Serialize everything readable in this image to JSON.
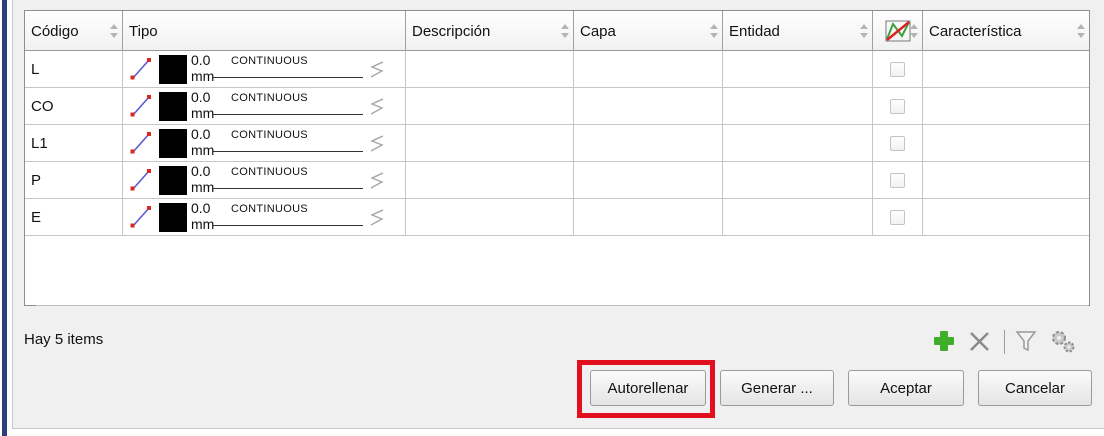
{
  "table": {
    "columns": [
      {
        "label": "Código"
      },
      {
        "label": "Tipo"
      },
      {
        "label": "Descripción"
      },
      {
        "label": "Capa"
      },
      {
        "label": "Entidad"
      },
      {
        "label": ""
      },
      {
        "label": "Característica"
      }
    ],
    "rows": [
      {
        "codigo": "L",
        "thickness": "0.0",
        "unit": "mm",
        "linetype": "CONTINUOUS",
        "descripcion": "",
        "capa": "",
        "entidad": "",
        "checked": false,
        "caracteristica": ""
      },
      {
        "codigo": "CO",
        "thickness": "0.0",
        "unit": "mm",
        "linetype": "CONTINUOUS",
        "descripcion": "",
        "capa": "",
        "entidad": "",
        "checked": false,
        "caracteristica": ""
      },
      {
        "codigo": "L1",
        "thickness": "0.0",
        "unit": "mm",
        "linetype": "CONTINUOUS",
        "descripcion": "",
        "capa": "",
        "entidad": "",
        "checked": false,
        "caracteristica": ""
      },
      {
        "codigo": "P",
        "thickness": "0.0",
        "unit": "mm",
        "linetype": "CONTINUOUS",
        "descripcion": "",
        "capa": "",
        "entidad": "",
        "checked": false,
        "caracteristica": ""
      },
      {
        "codigo": "E",
        "thickness": "0.0",
        "unit": "mm",
        "linetype": "CONTINUOUS",
        "descripcion": "",
        "capa": "",
        "entidad": "",
        "checked": false,
        "caracteristica": ""
      }
    ]
  },
  "icons": {
    "linetype": "polyline-icon",
    "style": "squiggle-icon",
    "header": "crossed-polyline-icon",
    "add": "add-icon",
    "delete": "delete-icon",
    "filter": "filter-icon",
    "settings": "settings-icon"
  },
  "status": {
    "count_text": "Hay 5 items"
  },
  "buttons": {
    "autofill": "Autorellenar",
    "generate": "Generar ...",
    "accept": "Aceptar",
    "cancel": "Cancelar"
  },
  "colors": {
    "highlight": "#e0101e",
    "line_icon": "#5b5bd6",
    "line_endpoint": "#d9281e",
    "swatch": "#000000",
    "add": "#3fae2a"
  }
}
